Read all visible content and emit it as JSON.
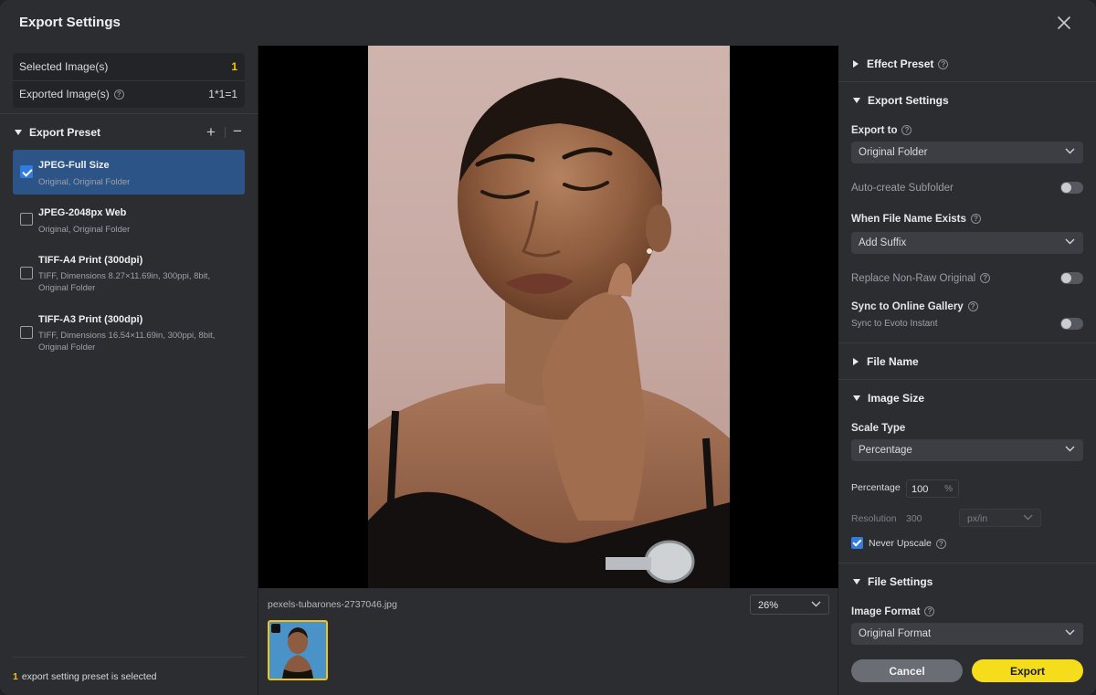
{
  "window": {
    "title": "Export Settings"
  },
  "summary": {
    "selected_label": "Selected Image(s)",
    "selected_value": "1",
    "exported_label": "Exported Image(s)",
    "exported_value": "1*1=1"
  },
  "presets": {
    "header": "Export Preset",
    "add_label": "+",
    "remove_label": "−",
    "items": [
      {
        "name": "JPEG-Full Size",
        "desc": "Original, Original Folder",
        "checked": true
      },
      {
        "name": "JPEG-2048px Web",
        "desc": "Original, Original Folder",
        "checked": false
      },
      {
        "name": "TIFF-A4 Print (300dpi)",
        "desc": "TIFF, Dimensions 8.27×11.69in, 300ppi, 8bit, Original Folder",
        "checked": false
      },
      {
        "name": "TIFF-A3 Print (300dpi)",
        "desc": "TIFF, Dimensions 16.54×11.69in, 300ppi, 8bit, Original Folder",
        "checked": false
      }
    ],
    "footer_count": "1",
    "footer_text": "export setting preset is selected"
  },
  "preview": {
    "filename": "pexels-tubarones-2737046.jpg",
    "zoom": "26%"
  },
  "right": {
    "effect_preset": "Effect Preset",
    "export_settings": "Export Settings",
    "export_to_label": "Export to",
    "export_to_value": "Original Folder",
    "auto_subfolder_label": "Auto-create Subfolder",
    "file_exists_label": "When File Name Exists",
    "file_exists_value": "Add Suffix",
    "replace_label": "Replace Non-Raw Original",
    "sync_label": "Sync to Online Gallery",
    "sync_sub": "Sync to Evoto Instant",
    "file_name": "File Name",
    "image_size": "Image Size",
    "scale_type_label": "Scale Type",
    "scale_type_value": "Percentage",
    "percentage_label": "Percentage",
    "percentage_value": "100",
    "percentage_unit": "%",
    "resolution_label": "Resolution",
    "resolution_value": "300",
    "resolution_unit": "px/in",
    "never_upscale_label": "Never Upscale",
    "file_settings": "File Settings",
    "image_format_label": "Image Format",
    "image_format_value": "Original Format"
  },
  "buttons": {
    "cancel": "Cancel",
    "export": "Export"
  },
  "colors": {
    "accent_yellow": "#f5dd1b",
    "selection_blue": "#2d5486",
    "checkbox_blue": "#2f7de1"
  }
}
